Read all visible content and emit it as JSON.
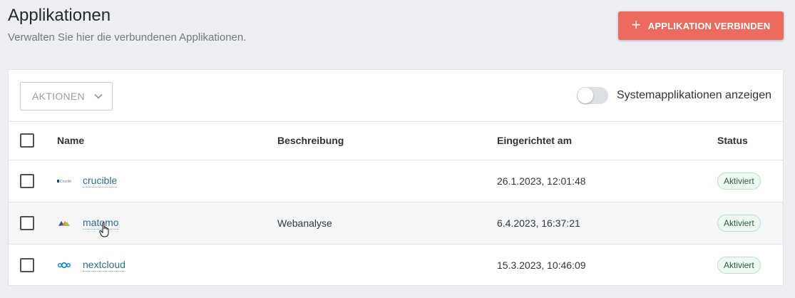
{
  "header": {
    "title": "Applikationen",
    "subtitle": "Verwalten Sie hier die verbundenen Applikationen.",
    "connect_button": "APPLIKATION VERBINDEN"
  },
  "toolbar": {
    "actions_label": "AKTIONEN",
    "toggle_label": "Systemapplikationen anzeigen",
    "toggle_on": false
  },
  "table": {
    "columns": [
      "Name",
      "Beschreibung",
      "Eingerichtet am",
      "Status"
    ],
    "rows": [
      {
        "name": "crucible",
        "logo": "crucible-logo",
        "description": "",
        "created": "26.1.2023, 12:01:48",
        "status": "Aktiviert"
      },
      {
        "name": "matomo",
        "logo": "matomo-logo",
        "description": "Webanalyse",
        "created": "6.4.2023, 16:37:21",
        "status": "Aktiviert"
      },
      {
        "name": "nextcloud",
        "logo": "nextcloud-logo",
        "description": "",
        "created": "15.3.2023, 10:46:09",
        "status": "Aktiviert"
      }
    ]
  },
  "colors": {
    "accent": "#ec6a5e",
    "link": "#2f6c8f",
    "status_bg": "#eef9f1"
  }
}
